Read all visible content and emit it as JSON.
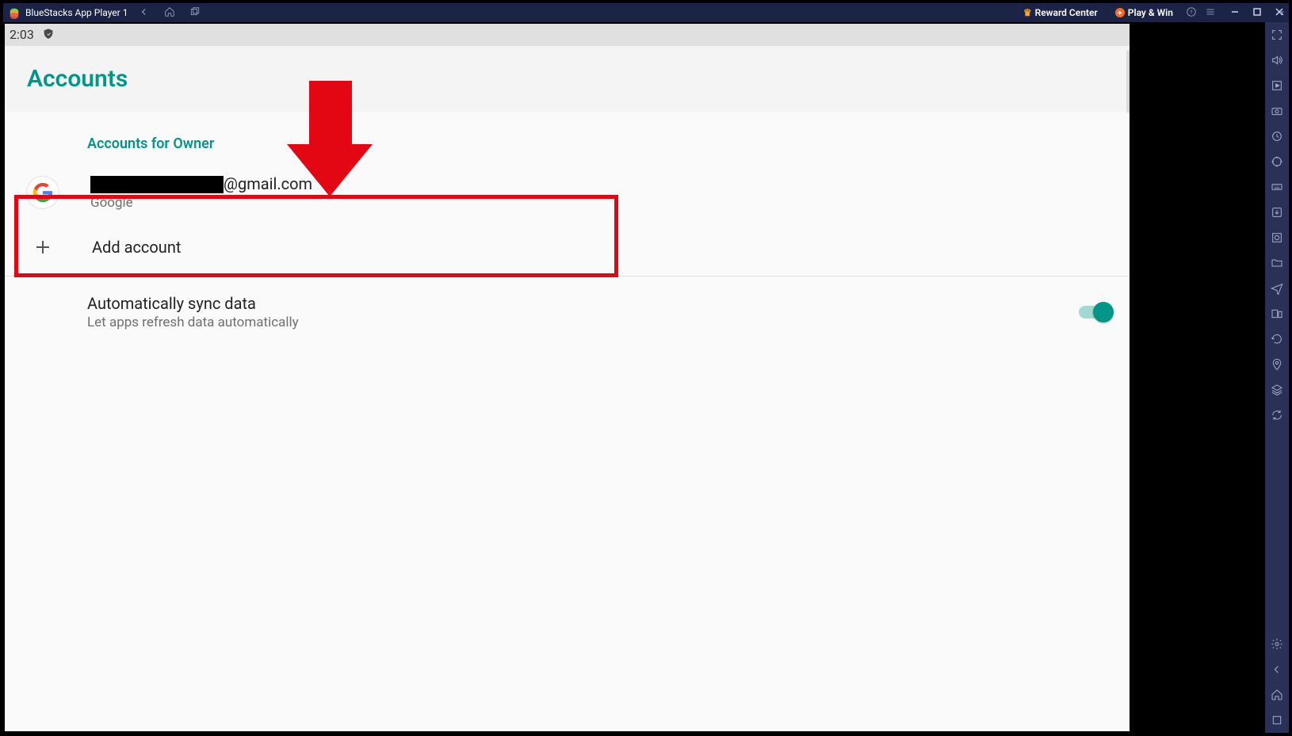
{
  "titlebar": {
    "app_title": "BlueStacks App Player 1",
    "reward_center_label": "Reward Center",
    "play_win_label": "Play & Win"
  },
  "statusbar": {
    "time": "2:03"
  },
  "page": {
    "title": "Accounts",
    "section_label": "Accounts for Owner",
    "account": {
      "email_suffix": "@gmail.com",
      "provider": "Google"
    },
    "add_account_label": "Add account",
    "sync": {
      "title": "Automatically sync data",
      "subtitle": "Let apps refresh data automatically",
      "enabled": true
    }
  },
  "colors": {
    "accent": "#009688",
    "annotation": "#e30613",
    "titlebar_bg": "#1b2347",
    "sidebar_bg": "#2a3156"
  },
  "redaction": {
    "email_prefix_hidden": true
  }
}
